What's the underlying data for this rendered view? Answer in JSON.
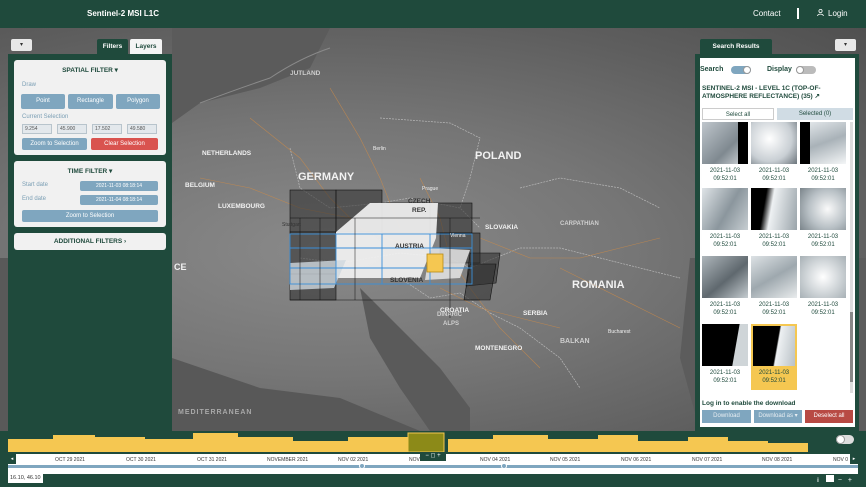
{
  "header": {
    "app_title": "Sentinel-2 MSI L1C",
    "contact_label": "Contact",
    "login_label": "Login",
    "brand_color": "#1f4a3c"
  },
  "left_tabs": {
    "filters": "Filters",
    "layers": "Layers"
  },
  "spatial_filter": {
    "title": "SPATIAL FILTER ▾",
    "draw_label": "Draw",
    "point_button": "Point",
    "rectangle_button": "Rectangle",
    "polygon_button": "Polygon",
    "current_selection_label": "Current Selection",
    "coords": [
      "9.254",
      "45.900",
      "17.502",
      "49.580"
    ],
    "zoom_button": "Zoom to Selection",
    "clear_button": "Clear Selection"
  },
  "time_filter": {
    "title": "TIME FILTER ▾",
    "start_label": "Start date",
    "start_value": "2021-11-03 08:18:14",
    "end_label": "End date",
    "end_value": "2021-11-04 08:18:14",
    "zoom_button": "Zoom to Selection"
  },
  "additional_filters": {
    "title": "ADDITIONAL FILTERS ›"
  },
  "results": {
    "tab_label": "Search Results",
    "search_toggle_label": "Search",
    "display_toggle_label": "Display",
    "collection_title": "SENTINEL-2 MSI - LEVEL 1C (TOP-OF-ATMOSPHERE REFLECTANCE) (35)",
    "select_all": "Select all",
    "selected": "Selected (0)",
    "thumbnails": [
      {
        "date": "2021-11-03",
        "time": "09:52:01"
      },
      {
        "date": "2021-11-03",
        "time": "09:52:01"
      },
      {
        "date": "2021-11-03",
        "time": "09:52:01"
      },
      {
        "date": "2021-11-03",
        "time": "09:52:01"
      },
      {
        "date": "2021-11-03",
        "time": "09:52:01"
      },
      {
        "date": "2021-11-03",
        "time": "09:52:01"
      },
      {
        "date": "2021-11-03",
        "time": "09:52:01"
      },
      {
        "date": "2021-11-03",
        "time": "09:52:01"
      },
      {
        "date": "2021-11-03",
        "time": "09:52:01"
      },
      {
        "date": "2021-11-03",
        "time": "09:52:01"
      },
      {
        "date": "2021-11-03",
        "time": "09:52:01"
      }
    ],
    "login_hint": "Log in to enable the download",
    "download_button": "Download",
    "download_as_button": "Download as ▾",
    "deselect_button": "Deselect all"
  },
  "map_labels": {
    "germany": "GERMANY",
    "poland": "POLAND",
    "romania": "ROMANIA",
    "netherlands": "NETHERLANDS",
    "belgium": "BELGIUM",
    "luxembourg": "LUXEMBOURG",
    "czech": "CZECH",
    "rep": "REP.",
    "austria": "AUSTRIA",
    "slovakia": "SLOVAKIA",
    "slovenia": "SLOVENIA",
    "croatia": "CROATIA",
    "serbia": "SERBIA",
    "montenegro": "MONTENEGRO",
    "balkan": "BALKAN",
    "dinaric": "DINARIC",
    "alps": "ALPS",
    "carpathian": "CARPATHIAN",
    "berlin": "Berlin",
    "prague": "Prague",
    "vienna": "Vienna",
    "bucharest": "Bucharest",
    "jutland": "JUTLAND",
    "mediterranean": "MEDITERRANEAN",
    "ce": "CE",
    "stuttgart": "Stuttgart"
  },
  "timeline": {
    "ticks": [
      "OCT 29 2021",
      "OCT 30 2021",
      "OCT 31 2021",
      "NOVEMBER 2021",
      "NOV 02 2021",
      "NOV 0",
      "NOV 04 2021",
      "NOV 05 2021",
      "NOV 06 2021",
      "NOV 07 2021",
      "NOV 08 2021",
      "NOV 0"
    ],
    "bar_color": "#f5c751"
  },
  "coords_readout": "16.10, 46.10"
}
